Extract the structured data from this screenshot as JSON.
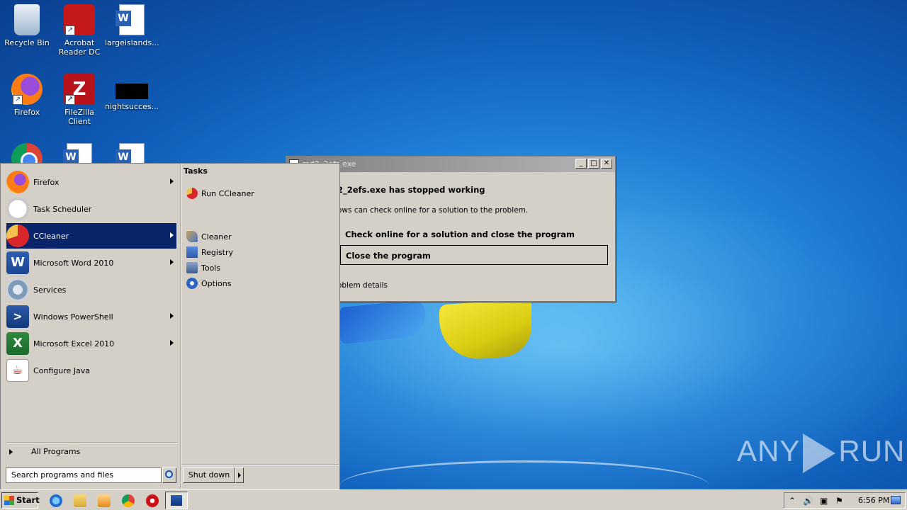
{
  "desktop": {
    "icons": [
      {
        "label": "Recycle Bin",
        "icon": "recycle-bin-icon"
      },
      {
        "label": "Acrobat Reader DC",
        "icon": "acrobat-icon"
      },
      {
        "label": "largeislands...",
        "icon": "word-document-icon"
      },
      {
        "label": "Firefox",
        "icon": "firefox-icon"
      },
      {
        "label": "FileZilla Client",
        "icon": "filezilla-icon"
      },
      {
        "label": "nightsucces...",
        "icon": "black-file-icon"
      }
    ]
  },
  "dialog": {
    "title": "md2_2efs.exe",
    "headline": "2_2efs.exe has stopped working",
    "subtext": "ows can check online for a solution to the problem.",
    "option_check": "Check online for a solution and close the program",
    "option_close": "Close the program",
    "details": "oblem details",
    "btn_min": "_",
    "btn_max": "□",
    "btn_close": "✕"
  },
  "startmenu": {
    "items": [
      {
        "label": "Firefox",
        "has_arrow": true
      },
      {
        "label": "Task Scheduler",
        "has_arrow": false
      },
      {
        "label": "CCleaner",
        "has_arrow": true,
        "active": true
      },
      {
        "label": "Microsoft Word 2010",
        "has_arrow": true
      },
      {
        "label": "Services",
        "has_arrow": false
      },
      {
        "label": "Windows PowerShell",
        "has_arrow": true
      },
      {
        "label": "Microsoft Excel 2010",
        "has_arrow": true
      },
      {
        "label": "Configure Java",
        "has_arrow": false
      }
    ],
    "icon_glyphs": {
      "word": "W",
      "powershell": ">",
      "excel": "X",
      "java": "☕"
    },
    "all_programs": "All Programs",
    "search_placeholder": "Search programs and files",
    "tasks_header": "Tasks",
    "tasks": [
      "Run CCleaner"
    ],
    "sub_items": [
      "Cleaner",
      "Registry",
      "Tools",
      "Options"
    ],
    "shutdown": "Shut down"
  },
  "taskbar": {
    "start": "Start",
    "clock": "6:56 PM",
    "tray_icons": [
      "show-hidden-icons-icon",
      "volume-icon",
      "network-icon",
      "action-center-flag-icon"
    ],
    "tray_glyphs": {
      "chevron": "⌃",
      "volume": "🔊",
      "network": "▣",
      "flag": "⚑"
    }
  },
  "watermark": {
    "left": "ANY",
    "right": "RUN"
  },
  "colors": {
    "selection": "#0a246a",
    "face": "#d4d0c8"
  }
}
